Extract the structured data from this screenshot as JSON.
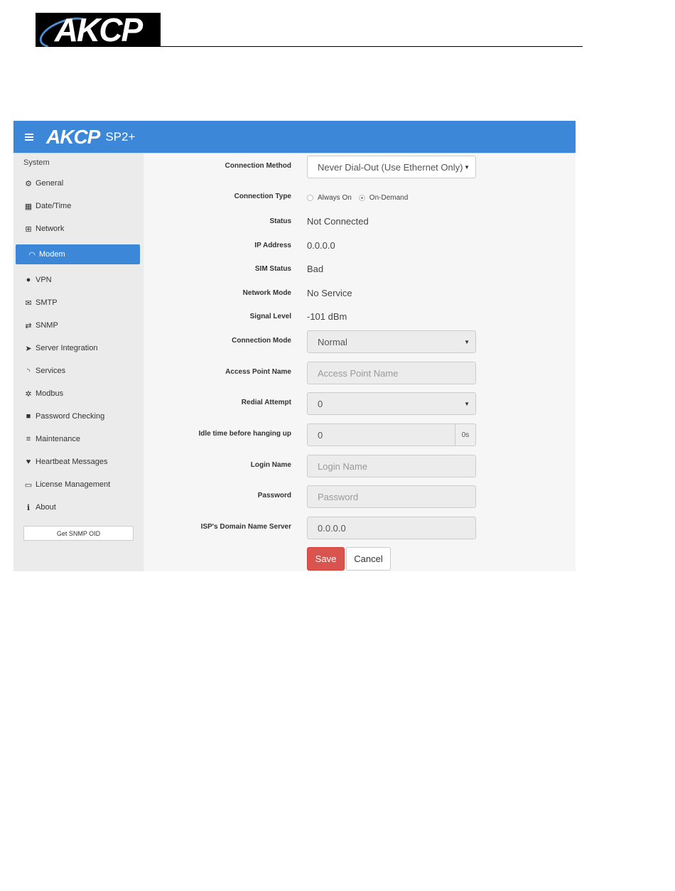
{
  "document": {
    "logo_text": "AKCP"
  },
  "app": {
    "logo_text": "AKCP",
    "product": "SP2+",
    "accent_color": "#3d87d9"
  },
  "sidebar": {
    "section_label": "System",
    "items": [
      {
        "label": "General",
        "icon": "gears-icon"
      },
      {
        "label": "Date/Time",
        "icon": "calendar-icon"
      },
      {
        "label": "Network",
        "icon": "sitemap-icon"
      },
      {
        "label": "Modem",
        "icon": "wifi-icon",
        "active": true
      },
      {
        "label": "VPN",
        "icon": "globe-icon"
      },
      {
        "label": "SMTP",
        "icon": "envelope-icon"
      },
      {
        "label": "SNMP",
        "icon": "exchange-icon"
      },
      {
        "label": "Server Integration",
        "icon": "paper-plane-icon"
      },
      {
        "label": "Services",
        "icon": "rss-icon"
      },
      {
        "label": "Modbus",
        "icon": "modbus-icon"
      },
      {
        "label": "Password Checking",
        "icon": "lock-icon"
      },
      {
        "label": "Maintenance",
        "icon": "database-icon"
      },
      {
        "label": "Heartbeat Messages",
        "icon": "heart-icon"
      },
      {
        "label": "License Management",
        "icon": "credit-card-icon"
      },
      {
        "label": "About",
        "icon": "info-icon"
      }
    ],
    "snmp_button": "Get SNMP OID"
  },
  "form": {
    "connection_method": {
      "label": "Connection Method",
      "value": "Never Dial-Out (Use Ethernet Only)"
    },
    "connection_type": {
      "label": "Connection Type",
      "options": [
        "Always On",
        "On-Demand"
      ],
      "selected": "On-Demand"
    },
    "status": {
      "label": "Status",
      "value": "Not Connected"
    },
    "ip_address": {
      "label": "IP Address",
      "value": "0.0.0.0"
    },
    "sim_status": {
      "label": "SIM Status",
      "value": "Bad"
    },
    "network_mode": {
      "label": "Network Mode",
      "value": "No Service"
    },
    "signal_level": {
      "label": "Signal Level",
      "value": "-101 dBm"
    },
    "connection_mode": {
      "label": "Connection Mode",
      "value": "Normal"
    },
    "access_point_name": {
      "label": "Access Point Name",
      "placeholder": "Access Point Name"
    },
    "redial_attempt": {
      "label": "Redial Attempt",
      "value": "0"
    },
    "idle_time": {
      "label": "Idle time before hanging up",
      "value": "0",
      "unit": "0s"
    },
    "login_name": {
      "label": "Login Name",
      "placeholder": "Login Name"
    },
    "password": {
      "label": "Password",
      "placeholder": "Password"
    },
    "isp_dns": {
      "label": "ISP's Domain Name Server",
      "value": "0.0.0.0"
    },
    "save_label": "Save",
    "cancel_label": "Cancel"
  }
}
